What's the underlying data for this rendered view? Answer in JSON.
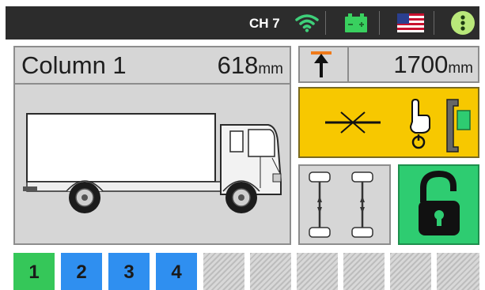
{
  "status_bar": {
    "channel": "CH 7",
    "icons": {
      "wifi": "wifi-icon",
      "battery": "battery-icon",
      "language": "us-flag-icon",
      "menu": "info-menu-icon"
    }
  },
  "column_panel": {
    "title": "Column 1",
    "value": "618",
    "unit": "mm"
  },
  "height_panel": {
    "value": "1700",
    "unit": "mm",
    "icon": "lift-height-arrow-icon"
  },
  "action_panel": {
    "icons": [
      "level-center-icon",
      "press-button-hand-icon",
      "column-lift-icon"
    ]
  },
  "axle_panel": {
    "icon": "axle-layout-icon"
  },
  "lock_panel": {
    "icon": "padlock-icon",
    "state": "unlocked"
  },
  "columns": [
    {
      "label": "1",
      "state": "active"
    },
    {
      "label": "2",
      "state": "connected"
    },
    {
      "label": "3",
      "state": "connected"
    },
    {
      "label": "4",
      "state": "connected"
    },
    {
      "label": "",
      "state": "empty"
    },
    {
      "label": "",
      "state": "empty"
    },
    {
      "label": "",
      "state": "empty"
    },
    {
      "label": "",
      "state": "empty"
    },
    {
      "label": "",
      "state": "empty"
    },
    {
      "label": "",
      "state": "empty"
    }
  ],
  "colors": {
    "active": "#35c759",
    "connected": "#2f8ff0",
    "warning_panel": "#f7c800",
    "lock_panel": "#2ecc71",
    "status_bar": "#2c2c2c"
  }
}
